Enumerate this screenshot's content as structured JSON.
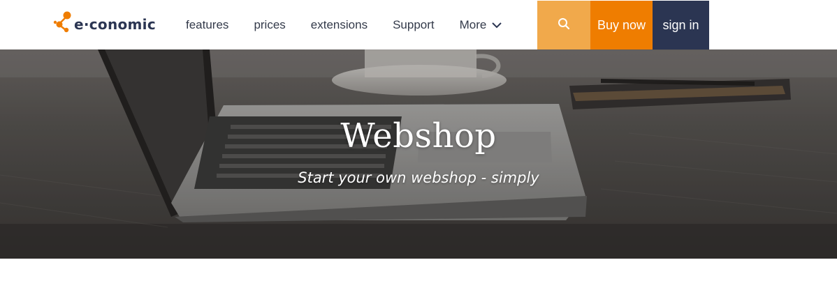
{
  "brand": {
    "name": "e·conomic",
    "logo_icon": "molecule-logo-icon",
    "colors": {
      "orange": "#ef7d00",
      "light_orange": "#f1a94b",
      "navy": "#2b3552"
    }
  },
  "nav": {
    "items": [
      {
        "label": "features"
      },
      {
        "label": "prices"
      },
      {
        "label": "extensions"
      },
      {
        "label": "Support"
      },
      {
        "label": "More",
        "icon": "chevron-down-icon"
      }
    ]
  },
  "actions": {
    "search_icon": "search-icon",
    "buy_label": "Buy now",
    "signin_label": "sign in"
  },
  "hero": {
    "title": "Webshop",
    "subtitle": "Start your own webshop - simply"
  }
}
